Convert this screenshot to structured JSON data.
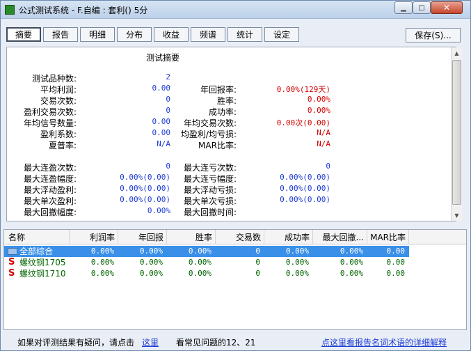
{
  "window": {
    "title": "公式测试系统 - F.自编 : 套利() 5分",
    "min_glyph": "▁",
    "max_glyph": "□",
    "close_glyph": "✕"
  },
  "tabs": [
    "摘要",
    "报告",
    "明细",
    "分布",
    "收益",
    "频谱",
    "统计",
    "设定"
  ],
  "active_tab": "摘要",
  "save_label": "保存(S)...",
  "summary": {
    "title": "测试摘要",
    "left": [
      {
        "label": "测试品种数:",
        "value": "2"
      },
      {
        "label": "平均利润:",
        "value": "0.00"
      },
      {
        "label": "交易次数:",
        "value": "0"
      },
      {
        "label": "盈利交易次数:",
        "value": "0"
      },
      {
        "label": "年均信号数量:",
        "value": "0.00"
      },
      {
        "label": "盈利系数:",
        "value": "0.00"
      },
      {
        "label": "夏普率:",
        "value": "N/A"
      }
    ],
    "right": [
      {
        "label": "年回报率:",
        "value": "0.00%(129天)"
      },
      {
        "label": "胜率:",
        "value": "0.00%"
      },
      {
        "label": "成功率:",
        "value": "0.00%"
      },
      {
        "label": "年均交易次数:",
        "value": "0.00次(0.00)"
      },
      {
        "label": "均盈利/均亏损:",
        "value": "N/A"
      },
      {
        "label": "MAR比率:",
        "value": "N/A"
      }
    ],
    "left2": [
      {
        "label": "最大连盈次数:",
        "value": "0"
      },
      {
        "label": "最大连盈幅度:",
        "value": "0.00%(0.00)"
      },
      {
        "label": "最大浮动盈利:",
        "value": "0.00%(0.00)"
      },
      {
        "label": "最大单次盈利:",
        "value": "0.00%(0.00)"
      },
      {
        "label": "最大回撤幅度:",
        "value": "0.00%"
      }
    ],
    "right2": [
      {
        "label": "最大连亏次数:",
        "value": "0"
      },
      {
        "label": "最大连亏幅度:",
        "value": "0.00%(0.00)"
      },
      {
        "label": "最大浮动亏损:",
        "value": "0.00%(0.00)"
      },
      {
        "label": "最大单次亏损:",
        "value": "0.00%(0.00)"
      },
      {
        "label": "最大回撤时间:",
        "value": ""
      }
    ]
  },
  "list": {
    "columns": [
      "名称",
      "利润率",
      "年回报",
      "胜率",
      "交易数",
      "成功率",
      "最大回撤...",
      "MAR比率"
    ],
    "rows": [
      {
        "icon": "folder-icon",
        "name": "全部综合",
        "cells": [
          "0.00%",
          "0.00%",
          "0.00%",
          "0",
          "0.00%",
          "0.00%",
          "0.00"
        ]
      },
      {
        "icon": "S",
        "name": "螺纹钢1705",
        "cells": [
          "0.00%",
          "0.00%",
          "0.00%",
          "0",
          "0.00%",
          "0.00%",
          "0.00"
        ]
      },
      {
        "icon": "S",
        "name": "螺纹钢1710",
        "cells": [
          "0.00%",
          "0.00%",
          "0.00%",
          "0",
          "0.00%",
          "0.00%",
          "0.00"
        ]
      }
    ]
  },
  "footer": {
    "question": "如果对评测结果有疑问，请点击",
    "here_link": "这里",
    "faq": "看常见问题的12、21",
    "glossary_link": "点这里看报告名词术语的详细解释"
  }
}
